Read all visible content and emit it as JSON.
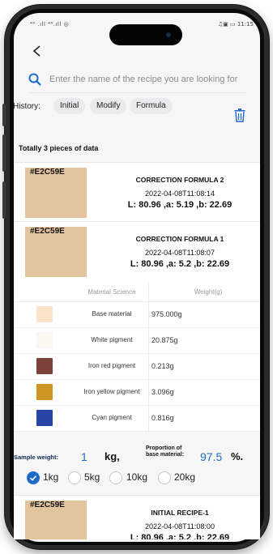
{
  "status_bar": {
    "left": "⁴⁶ .ıll ⁴⁶.ıll ◎",
    "right": "♫▣ ▭ 11:15"
  },
  "search": {
    "placeholder": "Enter the name of the recipe you are looking for"
  },
  "history": {
    "label": "History:",
    "chips": [
      "Initial",
      "Modify",
      "Formula"
    ]
  },
  "total_text": "Totally 3 pieces of data",
  "colors": {
    "accent": "#1d6bc9",
    "swatch": "#E2C59E"
  },
  "recipes": [
    {
      "hex": "#E2C59E",
      "title": "CORRECTION FORMULA 2",
      "date": "2022-04-08T11:08:14",
      "lab": "L: 80.96 ,a: 5.19 ,b: 22.69"
    },
    {
      "hex": "#E2C59E",
      "title": "CORRECTION FORMULA 1",
      "date": "2022-04-08T11:08:07",
      "lab": "L: 80.96 ,a: 5.2 ,b: 22.69"
    },
    {
      "hex": "#E2C59E",
      "title": "INITIAL RECIPE-1",
      "date": "2022-04-08T11:08:00",
      "lab": "L: 80.96 ,a: 5.2 ,b: 22.69"
    }
  ],
  "materials": {
    "headers": [
      "Material Science",
      "Weight(g)"
    ],
    "rows": [
      {
        "name": "Base material",
        "weight": "975.000g",
        "color": "#fde4c8"
      },
      {
        "name": "White pigment",
        "weight": "20.875g",
        "color": "#f8f7f0"
      },
      {
        "name": "Iron red pigment",
        "weight": "0.213g",
        "color": "#7a4238"
      },
      {
        "name": "Iron yellow pigment",
        "weight": "3.096g",
        "color": "#cf9624"
      },
      {
        "name": "Cyan pigment",
        "weight": "0.816g",
        "color": "#2744a6"
      }
    ]
  },
  "sample": {
    "weight_label": "Sample weight:",
    "weight_value": "1",
    "weight_unit": "kg,",
    "proportion_label_1": "Proportion of",
    "proportion_label_2": "base material:",
    "proportion_value": "97.5",
    "proportion_unit": "%."
  },
  "size_options": [
    {
      "label": "1kg",
      "selected": true
    },
    {
      "label": "5kg",
      "selected": false
    },
    {
      "label": "10kg",
      "selected": false
    },
    {
      "label": "20kg",
      "selected": false
    }
  ]
}
